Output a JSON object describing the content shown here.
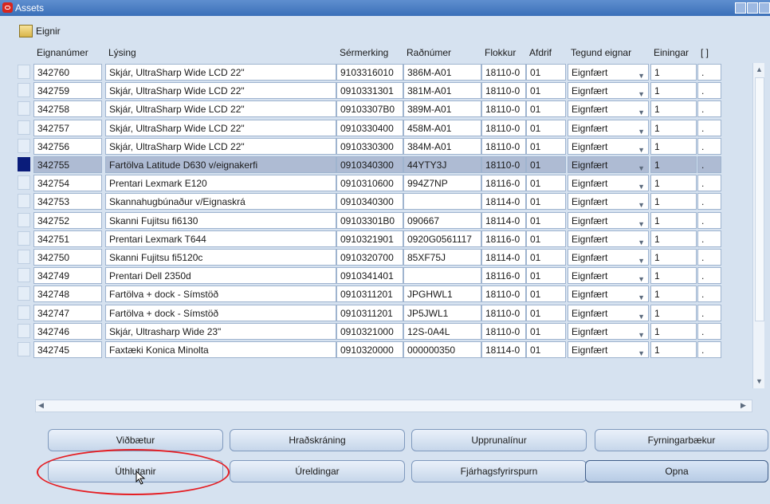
{
  "window": {
    "title": "Assets"
  },
  "toolbar": {
    "label": "Eignir"
  },
  "table": {
    "headers": [
      "Eignanúmer",
      "Lýsing",
      "Sérmerking",
      "Raðnúmer",
      "Flokkur",
      "Afdrif",
      "Tegund eignar",
      "Einingar",
      "[ ]"
    ],
    "selected_row_index": 5,
    "rows": [
      {
        "id": "342760",
        "desc": "Skjár, UltraSharp Wide LCD 22\"",
        "serial": "9103316010",
        "reg": "386M-A01",
        "cat": "18110-0",
        "afdrif": "01",
        "type": "Eignfært",
        "units": "1",
        "extra": "."
      },
      {
        "id": "342759",
        "desc": "Skjár, UltraSharp Wide LCD 22\"",
        "serial": "0910331301",
        "reg": "381M-A01",
        "cat": "18110-0",
        "afdrif": "01",
        "type": "Eignfært",
        "units": "1",
        "extra": "."
      },
      {
        "id": "342758",
        "desc": "Skjár, UltraSharp Wide LCD 22\"",
        "serial": "09103307B0",
        "reg": "389M-A01",
        "cat": "18110-0",
        "afdrif": "01",
        "type": "Eignfært",
        "units": "1",
        "extra": "."
      },
      {
        "id": "342757",
        "desc": "Skjár, UltraSharp Wide LCD 22\"",
        "serial": "0910330400",
        "reg": "458M-A01",
        "cat": "18110-0",
        "afdrif": "01",
        "type": "Eignfært",
        "units": "1",
        "extra": "."
      },
      {
        "id": "342756",
        "desc": "Skjár, UltraSharp Wide LCD 22\"",
        "serial": "0910330300",
        "reg": "384M-A01",
        "cat": "18110-0",
        "afdrif": "01",
        "type": "Eignfært",
        "units": "1",
        "extra": "."
      },
      {
        "id": "342755",
        "desc": "Fartölva Latitude D630 v/eignakerfi",
        "serial": "0910340300",
        "reg": "44YTY3J",
        "cat": "18110-0",
        "afdrif": "01",
        "type": "Eignfært",
        "units": "1",
        "extra": "."
      },
      {
        "id": "342754",
        "desc": "Prentari Lexmark E120",
        "serial": "0910310600",
        "reg": "994Z7NP",
        "cat": "18116-0",
        "afdrif": "01",
        "type": "Eignfært",
        "units": "1",
        "extra": "."
      },
      {
        "id": "342753",
        "desc": "Skannahugbúnaður v/Eignaskrá",
        "serial": "0910340300",
        "reg": "",
        "cat": "18114-0",
        "afdrif": "01",
        "type": "Eignfært",
        "units": "1",
        "extra": "."
      },
      {
        "id": "342752",
        "desc": "Skanni Fujitsu fi6130",
        "serial": "09103301B0",
        "reg": "090667",
        "cat": "18114-0",
        "afdrif": "01",
        "type": "Eignfært",
        "units": "1",
        "extra": "."
      },
      {
        "id": "342751",
        "desc": "Prentari Lexmark T644",
        "serial": "0910321901",
        "reg": "0920G0561117",
        "cat": "18116-0",
        "afdrif": "01",
        "type": "Eignfært",
        "units": "1",
        "extra": "."
      },
      {
        "id": "342750",
        "desc": "Skanni Fujitsu fi5120c",
        "serial": "0910320700",
        "reg": "85XF75J",
        "cat": "18114-0",
        "afdrif": "01",
        "type": "Eignfært",
        "units": "1",
        "extra": "."
      },
      {
        "id": "342749",
        "desc": "Prentari Dell 2350d",
        "serial": "0910341401",
        "reg": "",
        "cat": "18116-0",
        "afdrif": "01",
        "type": "Eignfært",
        "units": "1",
        "extra": "."
      },
      {
        "id": "342748",
        "desc": "Fartölva + dock - Símstöð",
        "serial": "0910311201",
        "reg": "JPGHWL1",
        "cat": "18110-0",
        "afdrif": "01",
        "type": "Eignfært",
        "units": "1",
        "extra": "."
      },
      {
        "id": "342747",
        "desc": "Fartölva + dock - Símstöð",
        "serial": "0910311201",
        "reg": "JP5JWL1",
        "cat": "18110-0",
        "afdrif": "01",
        "type": "Eignfært",
        "units": "1",
        "extra": "."
      },
      {
        "id": "342746",
        "desc": "Skjár, Ultrasharp Wide 23\"",
        "serial": "0910321000",
        "reg": "12S-0A4L",
        "cat": "18110-0",
        "afdrif": "01",
        "type": "Eignfært",
        "units": "1",
        "extra": "."
      },
      {
        "id": "342745",
        "desc": "Faxtæki Konica Minolta",
        "serial": "0910320000",
        "reg": "000000350",
        "cat": "18114-0",
        "afdrif": "01",
        "type": "Eignfært",
        "units": "1",
        "extra": "."
      }
    ]
  },
  "buttons": {
    "row1": [
      "Viðbætur",
      "Hraðskráning",
      "Upprunalínur",
      "Fyrningarbækur"
    ],
    "row2": [
      "Úthlutanir",
      "Úreldingar",
      "Fjárhagsfyrirspurn",
      "Opna"
    ]
  },
  "colors": {
    "titlebar": "#3a6fb8",
    "selection": "#aebbd3",
    "highlight_oval": "#e51d22"
  },
  "icons": [
    "app-icon",
    "folder-icon",
    "dropdown-arrow-icon",
    "cursor-icon"
  ]
}
